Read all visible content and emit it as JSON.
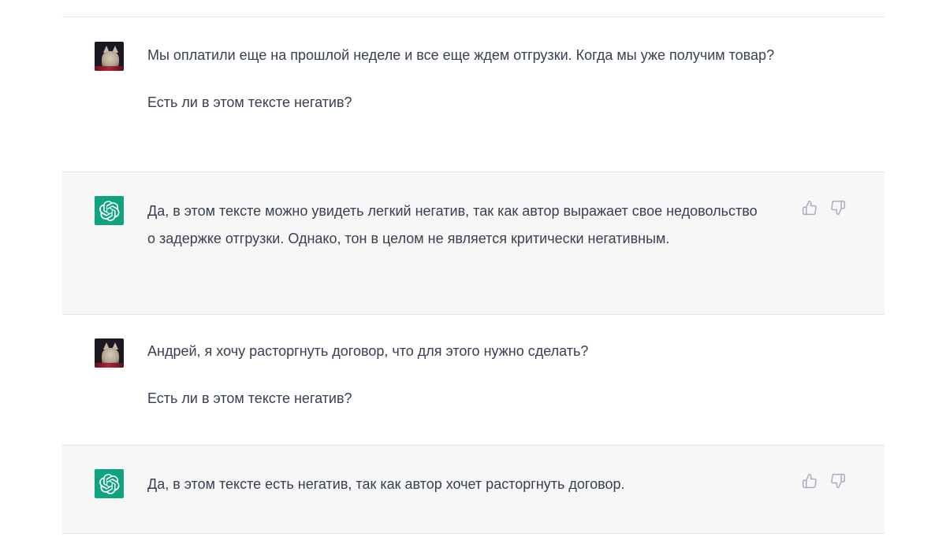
{
  "conversation": {
    "turns": [
      {
        "role": "user",
        "avatar_icon": "user-photo-cat",
        "paragraphs": [
          "Мы оплатили еще на прошлой неделе и все еще ждем отгрузки. Когда мы уже получим товар?",
          "Есть ли в этом тексте негатив?"
        ]
      },
      {
        "role": "assistant",
        "avatar_icon": "openai-logo-icon",
        "paragraphs": [
          "Да, в этом тексте можно увидеть легкий негатив, так как автор выражает свое недовольство о задержке отгрузки. Однако, тон в целом не является критически негативным."
        ],
        "feedback_icons": [
          "thumbs-up-icon",
          "thumbs-down-icon"
        ]
      },
      {
        "role": "user",
        "avatar_icon": "user-photo-cat",
        "paragraphs": [
          "Андрей, я хочу расторгнуть договор, что для этого нужно сделать?",
          "Есть ли в этом тексте негатив?"
        ]
      },
      {
        "role": "assistant",
        "avatar_icon": "openai-logo-icon",
        "paragraphs": [
          "Да, в этом тексте есть негатив, так как автор хочет расторгнуть договор."
        ],
        "feedback_icons": [
          "thumbs-up-icon",
          "thumbs-down-icon"
        ]
      }
    ]
  },
  "colors": {
    "assistant_bg": "#f7f7f8",
    "user_bg": "#ffffff",
    "brand_green": "#10a37f",
    "text": "#374151",
    "icon_gray": "#acacbe"
  }
}
